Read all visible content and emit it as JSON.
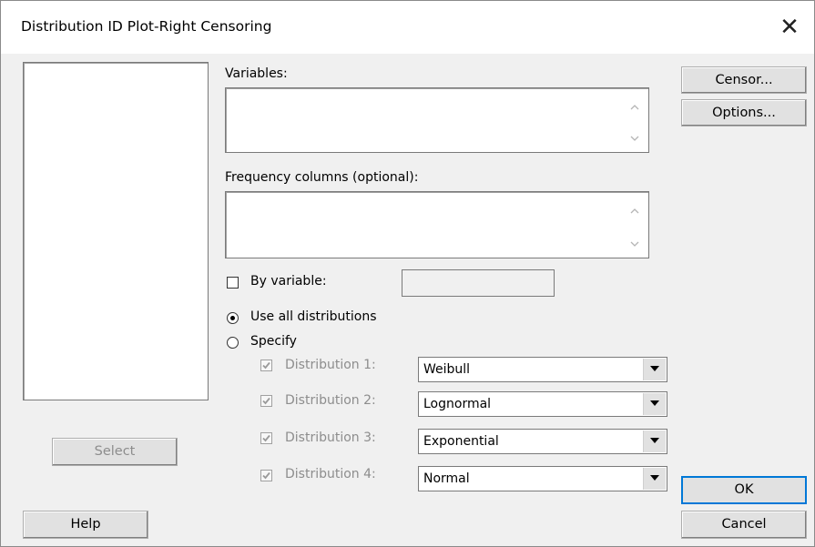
{
  "dialog": {
    "title": "Distribution ID Plot-Right Censoring",
    "close_glyph": "✕"
  },
  "variables": {
    "label": "Variables:"
  },
  "frequency": {
    "label": "Frequency columns (optional):"
  },
  "by_variable": {
    "label": "By variable:",
    "checked": false
  },
  "distribution_mode": {
    "use_all_label": "Use all distributions",
    "specify_label": "Specify",
    "selected": "use_all"
  },
  "distributions": [
    {
      "label": "Distribution 1:",
      "value": "Weibull",
      "checked": true
    },
    {
      "label": "Distribution 2:",
      "value": "Lognormal",
      "checked": true
    },
    {
      "label": "Distribution 3:",
      "value": "Exponential",
      "checked": true
    },
    {
      "label": "Distribution 4:",
      "value": "Normal",
      "checked": true
    }
  ],
  "buttons": {
    "censor": "Censor...",
    "options": "Options...",
    "select": "Select",
    "help": "Help",
    "ok": "OK",
    "cancel": "Cancel"
  },
  "icons": {
    "scroll_up": "chevron-up-icon",
    "scroll_down": "chevron-down-icon",
    "dropdown": "triangle-down-icon",
    "checkmark": "checkmark-icon"
  }
}
